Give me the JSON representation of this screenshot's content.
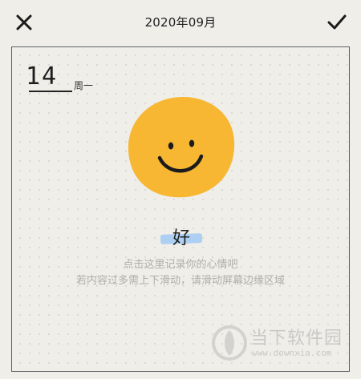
{
  "header": {
    "title": "2020年09月",
    "close_icon": "close-icon",
    "confirm_icon": "check-icon"
  },
  "entry": {
    "day": "14",
    "weekday": "周一",
    "mood": "好",
    "mood_icon": "smiley-face-icon",
    "colors": {
      "face": "#f7b733",
      "highlight": "#a9cdf2",
      "frame": "#5b5f66",
      "background": "#efeee9"
    }
  },
  "hints": {
    "line1": "点击这里记录你的心情吧",
    "line2": "若内容过多需上下滑动，请滑动屏幕边缘区域"
  },
  "watermark": {
    "name": "当下软件园",
    "url": "www.downxia.com"
  }
}
